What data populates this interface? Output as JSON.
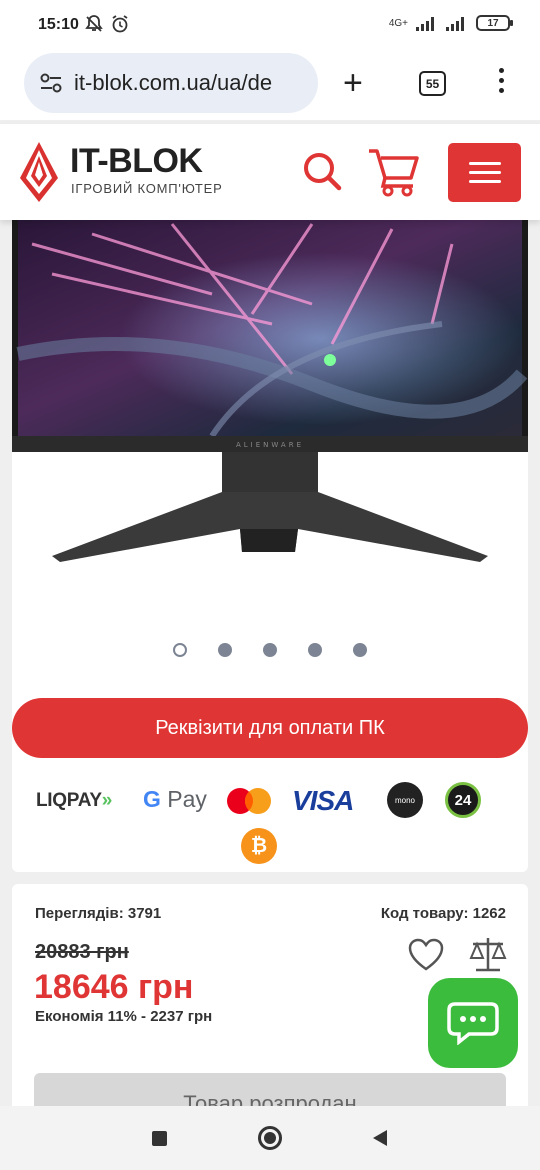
{
  "status": {
    "time": "15:10",
    "battery": "17",
    "network": "4G+"
  },
  "browser": {
    "url": "it-blok.com.ua/ua/de",
    "tab_count": "55"
  },
  "header": {
    "brand": "IT-BLOK",
    "subtitle": "ІГРОВИЙ КОМП'ЮТЕР"
  },
  "product": {
    "monitor_brand": "ALIENWARE",
    "pay_button": "Реквізити для оплати ПК",
    "payment_logos": {
      "liqpay": "LIQPAY",
      "gpay": "Pay",
      "visa": "VISA",
      "mono": "mono",
      "p24": "24",
      "btc": "₿"
    },
    "views": "Переглядів: 3791",
    "code": "Код товару: 1262",
    "old_price": "20883 грн",
    "new_price": "18646 грн",
    "economy": "Економія 11% - 2237 грн",
    "sold_button": "Товар розпродан",
    "carousel_total": 5,
    "carousel_active": 1
  },
  "colors": {
    "accent": "#e03535",
    "chat": "#3cbc3c"
  }
}
